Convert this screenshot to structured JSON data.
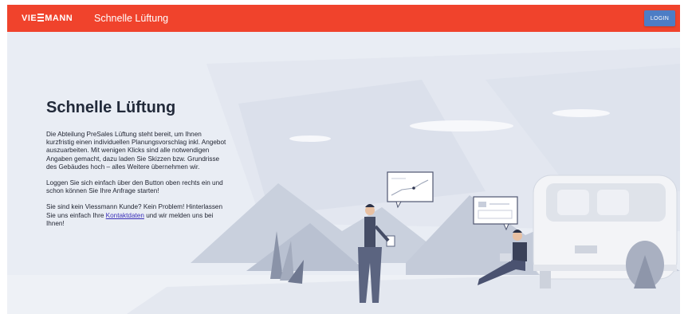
{
  "header": {
    "logo_left": "VIE",
    "logo_right": "MANN",
    "title": "Schnelle Lüftung",
    "login_label": "LOGIN"
  },
  "main": {
    "heading": "Schnelle Lüftung",
    "paragraph1": "Die Abteilung PreSales Lüftung steht bereit, um Ihnen kurzfristig einen individuellen Planungsvorschlag inkl. Angebot auszuarbeiten. Mit wenigen Klicks sind alle notwendigen Angaben gemacht, dazu laden Sie Skizzen bzw. Grundrisse des Gebäudes hoch – alles Weitere übernehmen wir.",
    "paragraph2": "Loggen Sie sich einfach über den Button oben rechts ein und schon können Sie Ihre Anfrage starten!",
    "paragraph3_before": "Sie sind kein Viessmann Kunde? Kein Problem! Hinterlassen Sie uns einfach Ihre ",
    "paragraph3_link": "Kontaktdaten",
    "paragraph3_after": " und wir melden uns bei Ihnen!"
  },
  "colors": {
    "header_bg": "#f0432c",
    "login_bg": "#4d7dc5",
    "page_bg": "#e8ecf3"
  }
}
